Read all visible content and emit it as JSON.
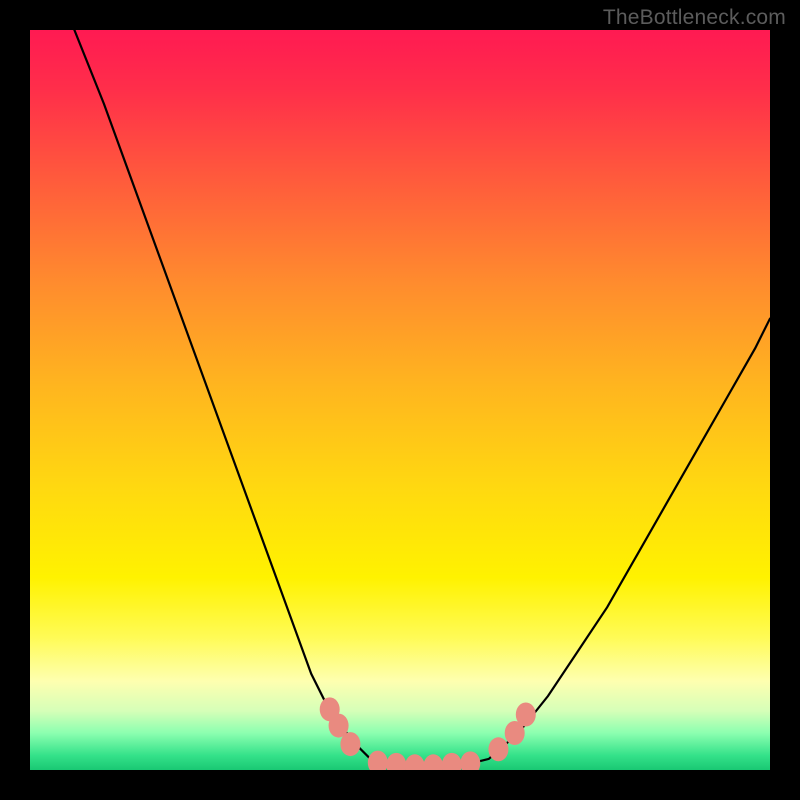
{
  "watermark": "TheBottleneck.com",
  "colors": {
    "background": "#000000",
    "curve": "#000000",
    "marker_fill": "#e98a80",
    "marker_stroke": "#c96a60"
  },
  "chart_data": {
    "type": "line",
    "title": "",
    "xlabel": "",
    "ylabel": "",
    "xlim": [
      0,
      100
    ],
    "ylim": [
      0,
      100
    ],
    "grid": false,
    "legend": false,
    "series": [
      {
        "name": "left-branch",
        "x": [
          6,
          10,
          14,
          18,
          22,
          26,
          30,
          34,
          38,
          40,
          42,
          44,
          46
        ],
        "values": [
          100,
          90,
          79,
          68,
          57,
          46,
          35,
          24,
          13,
          9,
          6,
          3.5,
          1.5
        ]
      },
      {
        "name": "valley-floor",
        "x": [
          46,
          48,
          50,
          52,
          54,
          56,
          58,
          60,
          62
        ],
        "values": [
          1.5,
          0.8,
          0.5,
          0.4,
          0.4,
          0.5,
          0.7,
          1.0,
          1.5
        ]
      },
      {
        "name": "right-branch",
        "x": [
          62,
          66,
          70,
          74,
          78,
          82,
          86,
          90,
          94,
          98,
          100
        ],
        "values": [
          1.5,
          5,
          10,
          16,
          22,
          29,
          36,
          43,
          50,
          57,
          61
        ]
      }
    ],
    "markers": [
      {
        "name": "left-upper-1",
        "x": 40.5,
        "y": 8.2
      },
      {
        "name": "left-upper-2",
        "x": 41.7,
        "y": 6.0
      },
      {
        "name": "left-lower",
        "x": 43.3,
        "y": 3.5
      },
      {
        "name": "floor-1",
        "x": 47.0,
        "y": 1.0
      },
      {
        "name": "floor-2",
        "x": 49.5,
        "y": 0.7
      },
      {
        "name": "floor-3",
        "x": 52.0,
        "y": 0.5
      },
      {
        "name": "floor-4",
        "x": 54.5,
        "y": 0.5
      },
      {
        "name": "floor-5",
        "x": 57.0,
        "y": 0.7
      },
      {
        "name": "floor-6",
        "x": 59.5,
        "y": 0.9
      },
      {
        "name": "right-lower",
        "x": 63.3,
        "y": 2.8
      },
      {
        "name": "right-upper-1",
        "x": 65.5,
        "y": 5.0
      },
      {
        "name": "right-upper-2",
        "x": 67.0,
        "y": 7.5
      }
    ]
  }
}
